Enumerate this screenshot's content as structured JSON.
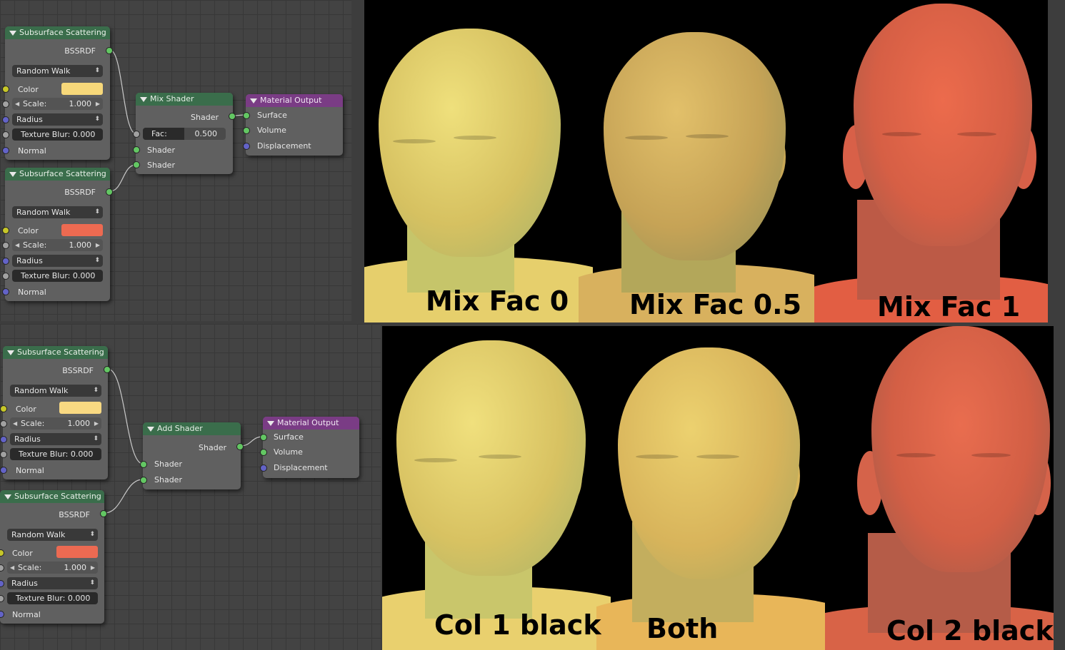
{
  "panels": [
    {
      "sss_nodes": [
        {
          "title": "Subsurface Scattering",
          "output": "BSSRDF",
          "method": "Random Walk",
          "color_label": "Color",
          "color": "#f7d87a",
          "scale_label": "Scale:",
          "scale_value": "1.000",
          "radius_label": "Radius",
          "blur_text": "Texture Blur: 0.000",
          "normal_label": "Normal"
        },
        {
          "title": "Subsurface Scattering",
          "output": "BSSRDF",
          "method": "Random Walk",
          "color_label": "Color",
          "color": "#ed6a51",
          "scale_label": "Scale:",
          "scale_value": "1.000",
          "radius_label": "Radius",
          "blur_text": "Texture Blur: 0.000",
          "normal_label": "Normal"
        }
      ],
      "combine_node": {
        "title": "Mix Shader",
        "output": "Shader",
        "fac_label": "Fac:",
        "fac_value": "0.500",
        "fac_fraction": 0.5,
        "input1": "Shader",
        "input2": "Shader"
      },
      "output_node": {
        "title": "Material Output",
        "surface": "Surface",
        "volume": "Volume",
        "displacement": "Displacement"
      }
    },
    {
      "sss_nodes": [
        {
          "title": "Subsurface Scattering",
          "output": "BSSRDF",
          "method": "Random Walk",
          "color_label": "Color",
          "color": "#f9d982",
          "scale_label": "Scale:",
          "scale_value": "1.000",
          "radius_label": "Radius",
          "blur_text": "Texture Blur: 0.000",
          "normal_label": "Normal"
        },
        {
          "title": "Subsurface Scattering",
          "output": "BSSRDF",
          "method": "Random Walk",
          "color_label": "Color",
          "color": "#ec6a52",
          "scale_label": "Scale:",
          "scale_value": "1.000",
          "radius_label": "Radius",
          "blur_text": "Texture Blur: 0.000",
          "normal_label": "Normal"
        }
      ],
      "combine_node": {
        "title": "Add Shader",
        "output": "Shader",
        "input1": "Shader",
        "input2": "Shader"
      },
      "output_node": {
        "title": "Material Output",
        "surface": "Surface",
        "volume": "Volume",
        "displacement": "Displacement"
      }
    }
  ],
  "renders": [
    {
      "captions": [
        "Mix Fac 0",
        "Mix Fac 0.5",
        "Mix Fac 1"
      ],
      "colors": [
        "#e6cf6c",
        "#d8b15e",
        "#e25e43"
      ]
    },
    {
      "captions": [
        "Col 1 black",
        "Both",
        "Col 2 black"
      ],
      "colors": [
        "#e9d06e",
        "#e8b659",
        "#d86347"
      ]
    }
  ]
}
